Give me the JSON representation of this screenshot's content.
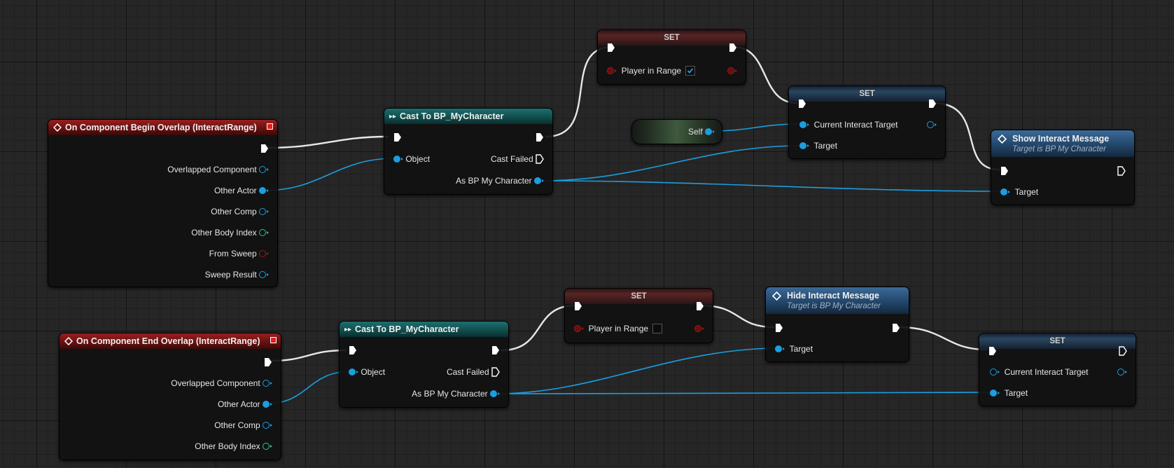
{
  "colors": {
    "exec_wire": "#e8e8e8",
    "object_wire": "#1b9ee0",
    "event_header": "#8a1a1a",
    "cast_header": "#176060",
    "function_header": "#34608c",
    "bool_pin": "#a01818",
    "int_pin": "#2bc98b",
    "checkbox_check": "#1b9ee0"
  },
  "begin_overlap": {
    "title": "On Component Begin Overlap (InteractRange)",
    "pins": [
      "Overlapped Component",
      "Other Actor",
      "Other Comp",
      "Other Body Index",
      "From Sweep",
      "Sweep Result"
    ]
  },
  "end_overlap": {
    "title": "On Component End Overlap (InteractRange)",
    "pins": [
      "Overlapped Component",
      "Other Actor",
      "Other Comp",
      "Other Body Index"
    ]
  },
  "cast_top": {
    "title": "Cast To BP_MyCharacter",
    "object_label": "Object",
    "cast_failed_label": "Cast Failed",
    "as_label": "As BP My Character"
  },
  "cast_bottom": {
    "title": "Cast To BP_MyCharacter",
    "object_label": "Object",
    "cast_failed_label": "Cast Failed",
    "as_label": "As BP My Character"
  },
  "set_range_top": {
    "title": "SET",
    "var_label": "Player in Range",
    "checked": true
  },
  "set_range_bottom": {
    "title": "SET",
    "var_label": "Player in Range",
    "checked": false
  },
  "self_node": {
    "label": "Self"
  },
  "set_target_top": {
    "title": "SET",
    "var_label": "Current Interact Target",
    "target_label": "Target"
  },
  "set_target_bottom": {
    "title": "SET",
    "var_label": "Current Interact Target",
    "target_label": "Target"
  },
  "show_msg": {
    "title": "Show Interact Message",
    "subtitle": "Target is BP My Character",
    "target_label": "Target"
  },
  "hide_msg": {
    "title": "Hide Interact Message",
    "subtitle": "Target is BP My Character",
    "target_label": "Target"
  },
  "icons": {
    "event": "diamond-event-icon",
    "cast": "cast-arrows-icon",
    "function": "function-diamond-icon",
    "exec": "exec-arrow-icon",
    "close": "red-square-icon"
  }
}
